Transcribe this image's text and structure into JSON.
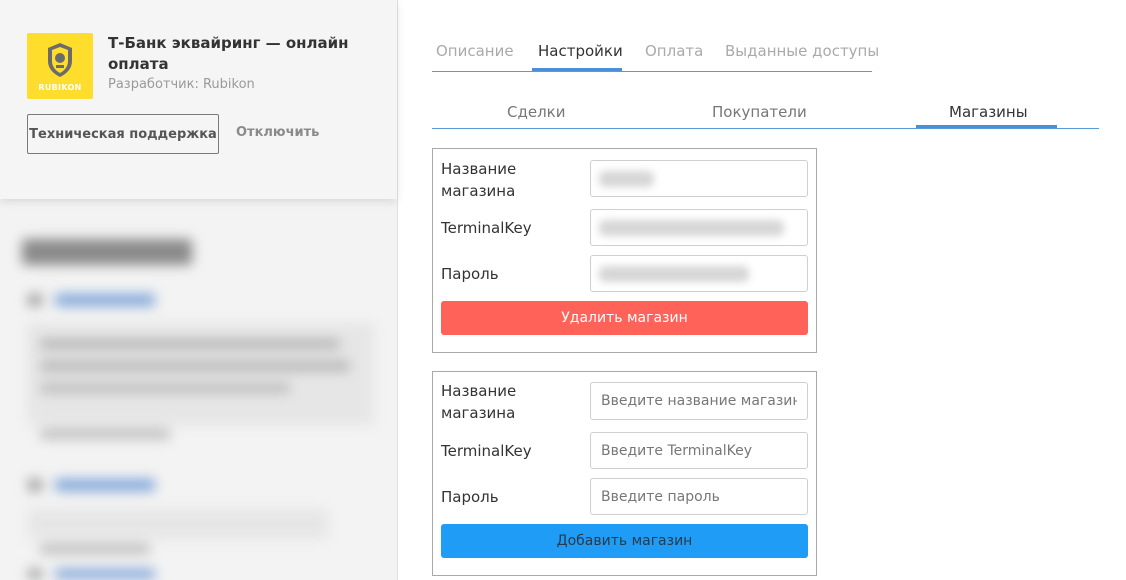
{
  "app": {
    "title": "Т-Банк эквайринг — онлайн оплата",
    "developer": "Разработчик: Rubikon",
    "logo_text": "RUBIKON",
    "support_label": "Техническая поддержка",
    "disable_label": "Отключить"
  },
  "top_tabs": [
    {
      "label": "Описание",
      "active": false
    },
    {
      "label": "Настройки",
      "active": true
    },
    {
      "label": "Оплата",
      "active": false
    },
    {
      "label": "Выданные доступы",
      "active": false
    }
  ],
  "sub_tabs": [
    {
      "label": "Сделки",
      "active": false
    },
    {
      "label": "Покупатели",
      "active": false
    },
    {
      "label": "Магазины",
      "active": true
    }
  ],
  "existing_store": {
    "name_label": "Название магазина",
    "terminal_label": "TerminalKey",
    "password_label": "Пароль",
    "delete_label": "Удалить магазин"
  },
  "new_store": {
    "name_label": "Название магазина",
    "name_placeholder": "Введите название магазина",
    "terminal_label": "TerminalKey",
    "terminal_placeholder": "Введите TerminalKey",
    "password_label": "Пароль",
    "password_placeholder": "Введите пароль",
    "add_label": "Добавить магазин"
  },
  "colors": {
    "accent": "#4a90d9",
    "delete": "#ff6258",
    "add": "#1f9cf5",
    "logo_bg": "#ffdd2d"
  }
}
